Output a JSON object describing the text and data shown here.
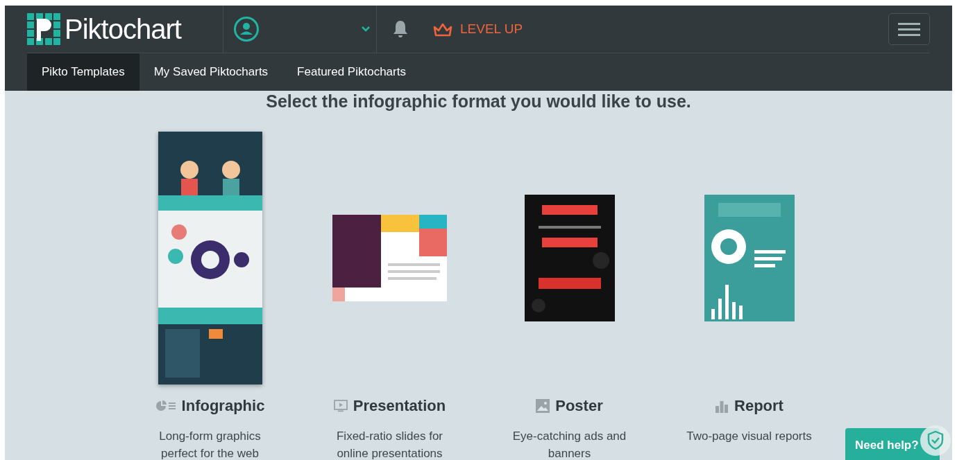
{
  "header": {
    "logo": "**Pikto**chart",
    "level_up": "LEVEL UP"
  },
  "tabs": [
    {
      "label": "Pikto Templates",
      "selected": true
    },
    {
      "label": "My Saved Piktocharts",
      "selected": false
    },
    {
      "label": "Featured Piktocharts",
      "selected": false
    }
  ],
  "heading": "Select the infographic format you would like to use.",
  "formats": [
    {
      "kind": "infographic",
      "title": "Infographic",
      "description": "Long-form graphics perfect for the web"
    },
    {
      "kind": "presentation",
      "title": "Presentation",
      "description": "Fixed-ratio slides for online presentations"
    },
    {
      "kind": "poster",
      "title": "Poster",
      "description": "Eye-catching ads and banners"
    },
    {
      "kind": "report",
      "title": "Report",
      "description": "Two-page visual reports"
    }
  ],
  "help_button": "Need help?"
}
